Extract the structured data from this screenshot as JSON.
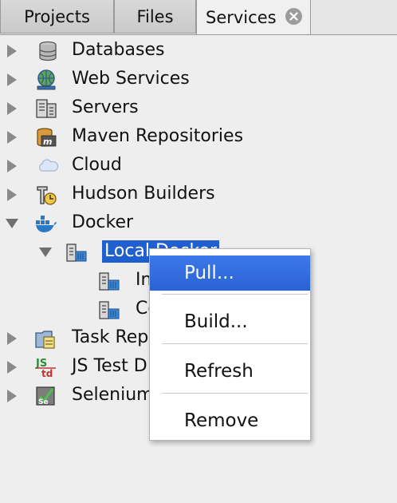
{
  "tabs": [
    {
      "label": "Projects"
    },
    {
      "label": "Files"
    },
    {
      "label": "Services",
      "active": true
    }
  ],
  "tree": {
    "nodes": [
      {
        "label": "Databases",
        "icon": "database-icon",
        "expanded": false
      },
      {
        "label": "Web Services",
        "icon": "web-services-icon",
        "expanded": false
      },
      {
        "label": "Servers",
        "icon": "server-icon",
        "expanded": false
      },
      {
        "label": "Maven Repositories",
        "icon": "maven-icon",
        "expanded": false
      },
      {
        "label": "Cloud",
        "icon": "cloud-icon",
        "expanded": false
      },
      {
        "label": "Hudson Builders",
        "icon": "hudson-icon",
        "expanded": false
      },
      {
        "label": "Docker",
        "icon": "docker-icon",
        "expanded": true
      },
      {
        "label": "Local Docker",
        "icon": "docker-instance-icon",
        "expanded": true,
        "selected": true
      },
      {
        "label": "In",
        "icon": "images-icon"
      },
      {
        "label": "Co",
        "icon": "containers-icon"
      },
      {
        "label": "Task Rep",
        "icon": "task-repo-icon",
        "expanded": false
      },
      {
        "label": "JS Test D",
        "icon": "js-test-icon",
        "expanded": false
      },
      {
        "label": "Selenium",
        "icon": "selenium-icon",
        "expanded": false
      }
    ]
  },
  "context_menu": {
    "items": [
      {
        "label": "Pull...",
        "highlighted": true
      },
      {
        "label": "Build..."
      },
      {
        "label": "Refresh"
      },
      {
        "label": "Remove"
      }
    ]
  },
  "colors": {
    "selection": "#1f5fd0",
    "menu_highlight": "#2a63d4",
    "background": "#eeeeee"
  }
}
